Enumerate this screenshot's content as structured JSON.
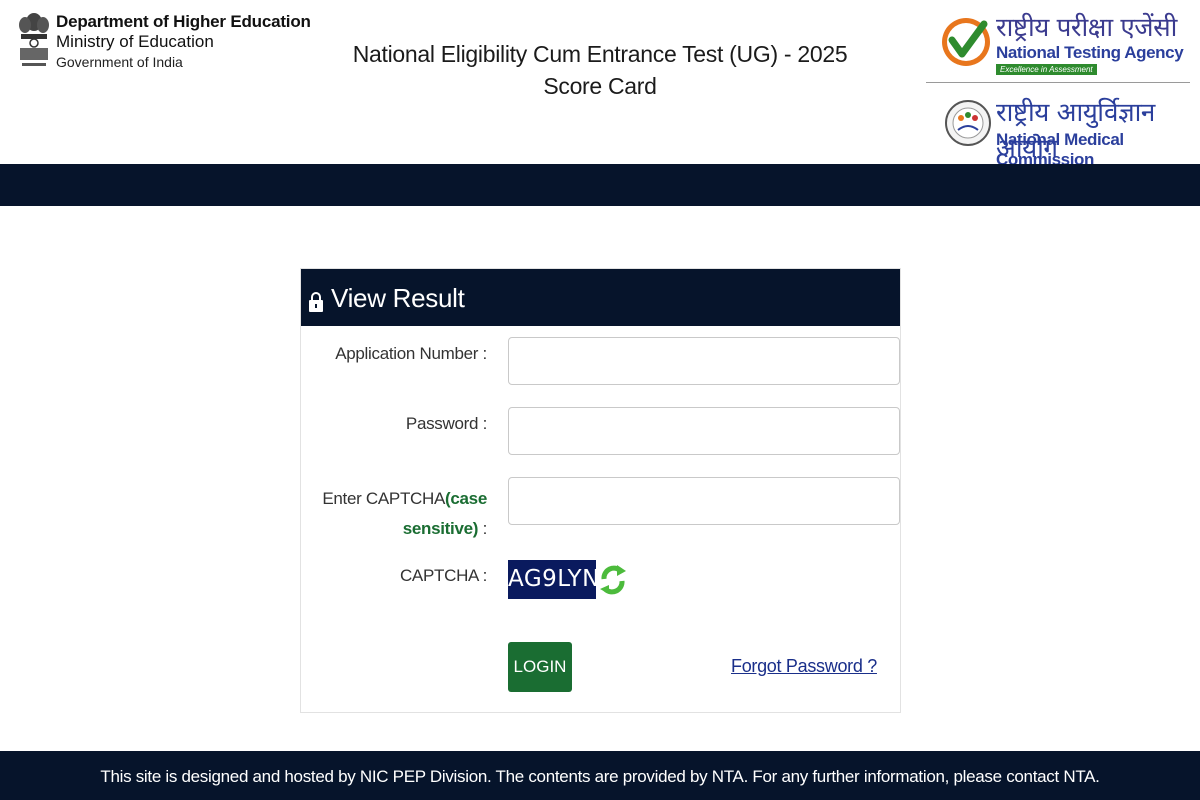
{
  "header": {
    "dept_line1": "Department of Higher Education",
    "dept_line2": "Ministry of Education",
    "dept_line3": "Government of India",
    "title_line1": "National Eligibility Cum Entrance Test (UG) - 2025",
    "title_line2": "Score Card",
    "nta_hindi": "राष्ट्रीय परीक्षा एजेंसी",
    "nta_name": "National Testing Agency",
    "nta_tagline": "Excellence in Assessment",
    "nmc_hindi": "राष्ट्रीय आयुर्विज्ञान आयोग",
    "nmc_name": "National Medical Commission",
    "emblem_icon": "national-emblem-icon",
    "nta_logo_icon": "nta-check-logo-icon",
    "nmc_logo_icon": "nmc-seal-logo-icon"
  },
  "panel": {
    "title": "View Result",
    "title_icon": "lock-icon",
    "application_label": "Application Number :",
    "application_value": "",
    "application_placeholder": "",
    "password_label": "Password :",
    "password_value": "",
    "password_placeholder": "",
    "captcha_input_label_prefix": "Enter CAPTCHA",
    "captcha_input_label_case_line1": "(case",
    "captcha_input_label_case_line2": "sensitive)",
    "captcha_input_label_suffix": " :",
    "captcha_input_value": "",
    "captcha_input_placeholder": "",
    "captcha_label": "CAPTCHA :",
    "captcha_text": "AG9LYN",
    "refresh_icon": "refresh-icon",
    "login_label": "LOGIN",
    "forgot_label": "Forgot Password ?"
  },
  "footer": {
    "text": "This site is designed and hosted by NIC PEP Division. The contents are provided by NTA. For any further information, please contact NTA."
  },
  "colors": {
    "navy": "#06142b",
    "green": "#1a6d32",
    "link_blue": "#1a2f8a",
    "captcha_bg": "#0a1a5e"
  }
}
